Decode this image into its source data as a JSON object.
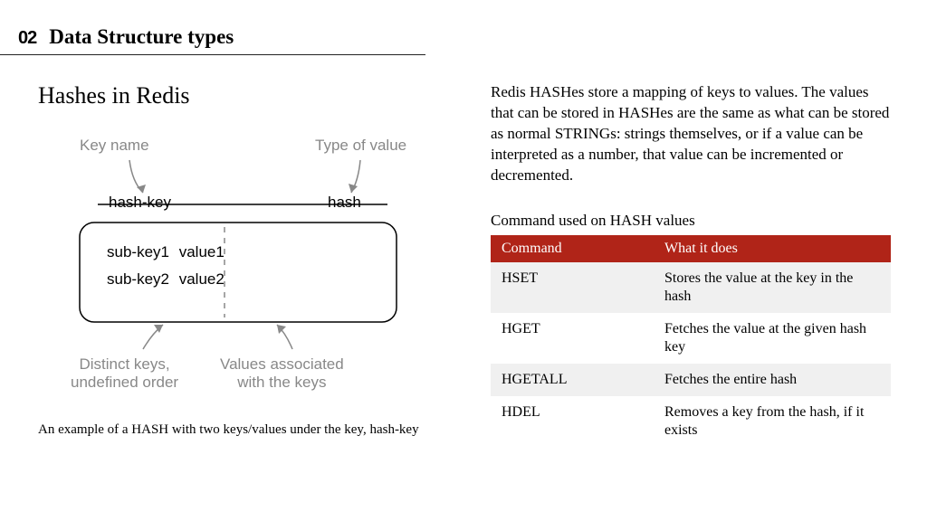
{
  "header": {
    "number": "02",
    "title": "Data Structure types"
  },
  "subtitle": "Hashes in Redis",
  "diagram": {
    "key_name_label": "Key name",
    "type_of_value_label": "Type of value",
    "hash_key": "hash-key",
    "hash_type": "hash",
    "row1_key": "sub-key1",
    "row1_val": "value1",
    "row2_key": "sub-key2",
    "row2_val": "value2",
    "distinct_label_l1": "Distinct keys,",
    "distinct_label_l2": "undefined order",
    "values_label_l1": "Values associated",
    "values_label_l2": "with the keys"
  },
  "caption": "An example of a HASH with two keys/values under the key, hash-key",
  "paragraph": "Redis HASHes store a mapping of keys to values. The values that can be stored in HASHes are the same as what can be stored as normal STRINGs: strings themselves, or if a value can be interpreted as a number, that value can be incremented or decremented.",
  "table_title": "Command used on HASH values",
  "table": {
    "headers": [
      "Command",
      "What it does"
    ],
    "rows": [
      {
        "cmd": "HSET",
        "desc": "Stores the value at the key in the hash"
      },
      {
        "cmd": "HGET",
        "desc": "Fetches the value at the given hash key"
      },
      {
        "cmd": "HGETALL",
        "desc": "Fetches the entire hash"
      },
      {
        "cmd": "HDEL",
        "desc": "Removes a key from the hash, if it exists"
      }
    ]
  }
}
